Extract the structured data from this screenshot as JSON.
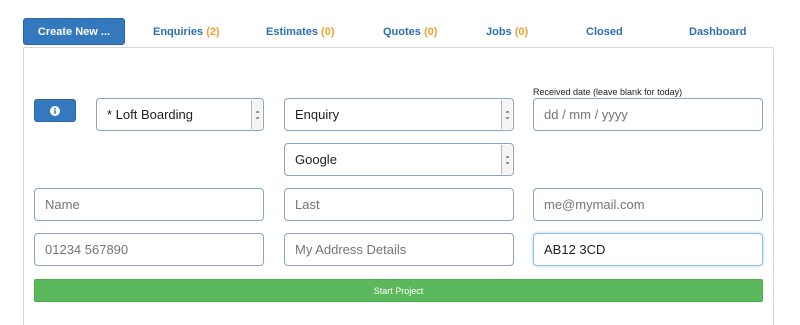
{
  "tabs": {
    "create": "Create New ...",
    "enquiries": {
      "label": "Enquiries",
      "count": "(2)"
    },
    "estimates": {
      "label": "Estimates",
      "count": "(0)"
    },
    "quotes": {
      "label": "Quotes",
      "count": "(0)"
    },
    "jobs": {
      "label": "Jobs",
      "count": "(0)"
    },
    "closed": "Closed",
    "dashboard": "Dashboard"
  },
  "form": {
    "info_icon": "info-circle-icon",
    "service_select": "* Loft Boarding",
    "type_select": "Enquiry",
    "source_select": "Google",
    "received_date_label": "Received date (leave blank for today)",
    "received_date_placeholder": "dd / mm / yyyy",
    "first_name_placeholder": "Name",
    "last_name_placeholder": "Last",
    "email_placeholder": "me@mymail.com",
    "phone_placeholder": "01234 567890",
    "address_placeholder": "My Address Details",
    "postcode_value": "AB12 3CD",
    "start_button": "Start Project"
  },
  "colors": {
    "primary": "#3478be",
    "count": "#f0a030",
    "success": "#5cb85c"
  }
}
